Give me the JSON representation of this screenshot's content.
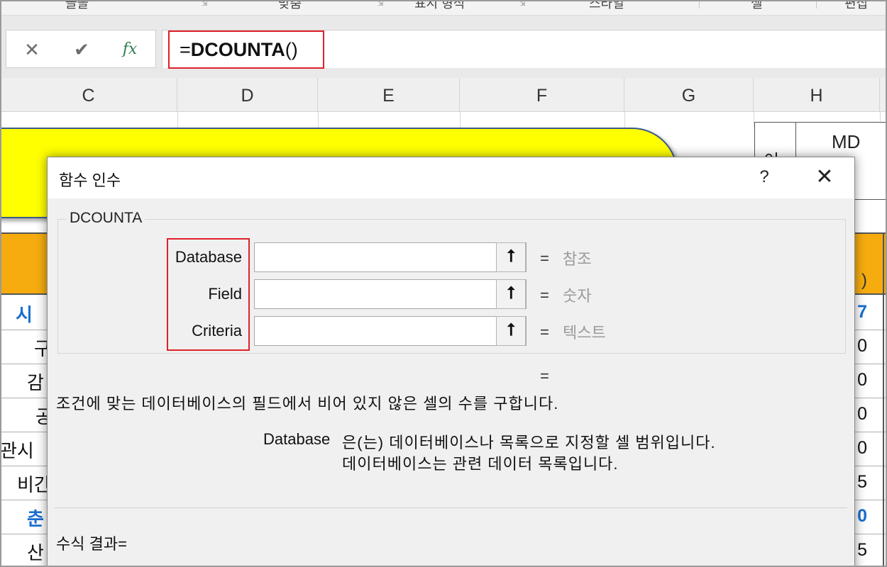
{
  "ribbon": {
    "groups": [
      "맞춤",
      "표시 형식",
      "스타일",
      "셀",
      "편집"
    ],
    "launcher_glyph": "⇲"
  },
  "formula_bar": {
    "cancel_symbol": "✕",
    "enter_symbol": "✔",
    "fx_label": "fx",
    "formula_prefix": "=",
    "formula_function": "DCOUNTA",
    "formula_suffix": "()"
  },
  "columns": [
    "C",
    "D",
    "E",
    "F",
    "G",
    "H"
  ],
  "sheet": {
    "banner_text": "",
    "md_label": "MD",
    "header_right_text": ")",
    "rows": [
      {
        "left": "시",
        "right": "7",
        "highlight": true
      },
      {
        "left": "구",
        "right": "0",
        "highlight": false
      },
      {
        "left": "감",
        "right": "0",
        "highlight": false
      },
      {
        "left": "공",
        "right": "0",
        "highlight": false
      },
      {
        "left": "관시",
        "right": "0",
        "highlight": false
      },
      {
        "left": "비간",
        "right": "5",
        "highlight": false
      },
      {
        "left": "춘",
        "right": "0",
        "highlight": true
      },
      {
        "left": "산",
        "right": "5",
        "highlight": false
      }
    ]
  },
  "dialog": {
    "title": "함수 인수",
    "help_symbol": "?",
    "close_symbol": "✕",
    "function_name": "DCOUNTA",
    "arguments": [
      {
        "label": "Database",
        "value": "",
        "type_hint": "참조"
      },
      {
        "label": "Field",
        "value": "",
        "type_hint": "숫자"
      },
      {
        "label": "Criteria",
        "value": "",
        "type_hint": "텍스트"
      }
    ],
    "collapse_symbol": "⭡",
    "equals": "=",
    "description": "조건에 맞는 데이터베이스의 필드에서 비어 있지 않은 셀의 수를 구합니다.",
    "arg_help_name": "Database",
    "arg_help_line1": "은(는) 데이터베이스나 목록으로 지정할 셀 범위입니다.",
    "arg_help_line2": "데이터베이스는 관련 데이터 목록입니다.",
    "formula_result_label": "수식 결과="
  },
  "colors": {
    "highlight_red": "#e0202a",
    "banner_yellow": "#ffff00",
    "header_orange": "#f6ac0f",
    "accent_blue": "#1a6fd0",
    "fx_green": "#2f7d4f"
  }
}
